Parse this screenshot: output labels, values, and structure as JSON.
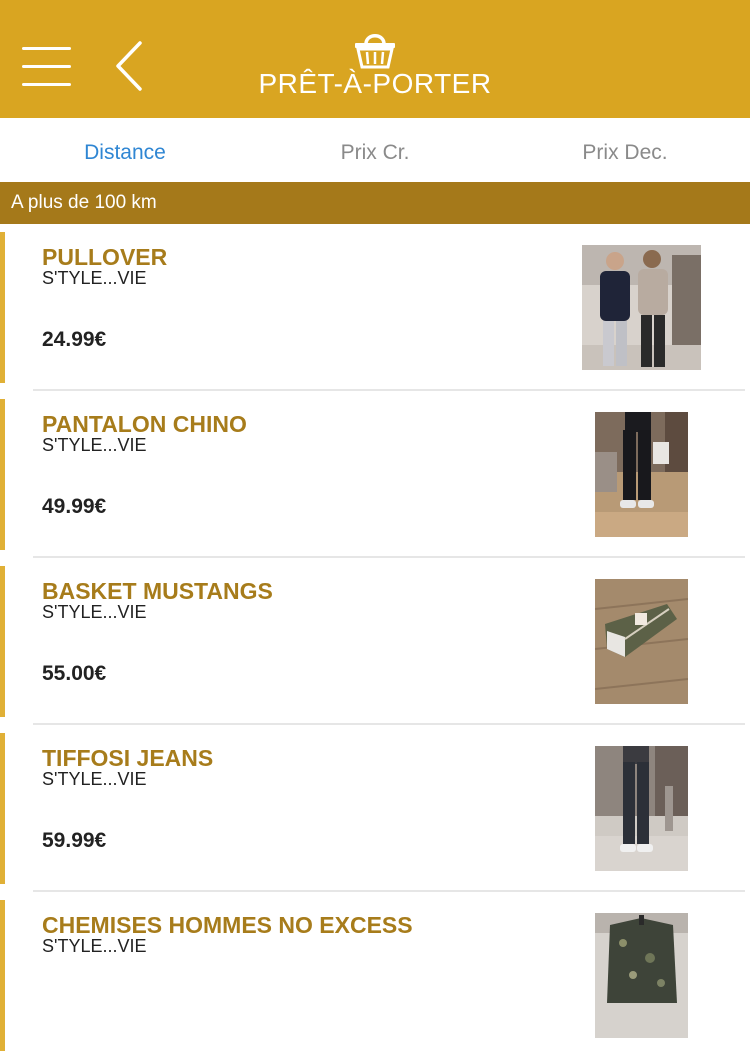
{
  "header": {
    "title": "PRÊT-À-PORTER",
    "accent_color": "#d9a521",
    "icons": {
      "menu": "hamburger-icon",
      "back": "chevron-left-icon",
      "logo": "basket-icon"
    }
  },
  "sort_tabs": [
    {
      "label": "Distance",
      "active": true
    },
    {
      "label": "Prix Cr.",
      "active": false
    },
    {
      "label": "Prix Dec.",
      "active": false
    }
  ],
  "section_header": "A plus de 100 km",
  "products": [
    {
      "name": "PULLOVER",
      "shop": "S'TYLE...VIE",
      "price": "24.99€"
    },
    {
      "name": "PANTALON CHINO",
      "shop": "S'TYLE...VIE",
      "price": "49.99€"
    },
    {
      "name": "BASKET MUSTANGS",
      "shop": "S'TYLE...VIE",
      "price": "55.00€"
    },
    {
      "name": "TIFFOSI JEANS",
      "shop": "S'TYLE...VIE",
      "price": "59.99€"
    },
    {
      "name": "CHEMISES HOMMES NO EXCESS",
      "shop": "S'TYLE...VIE",
      "price": ""
    }
  ]
}
